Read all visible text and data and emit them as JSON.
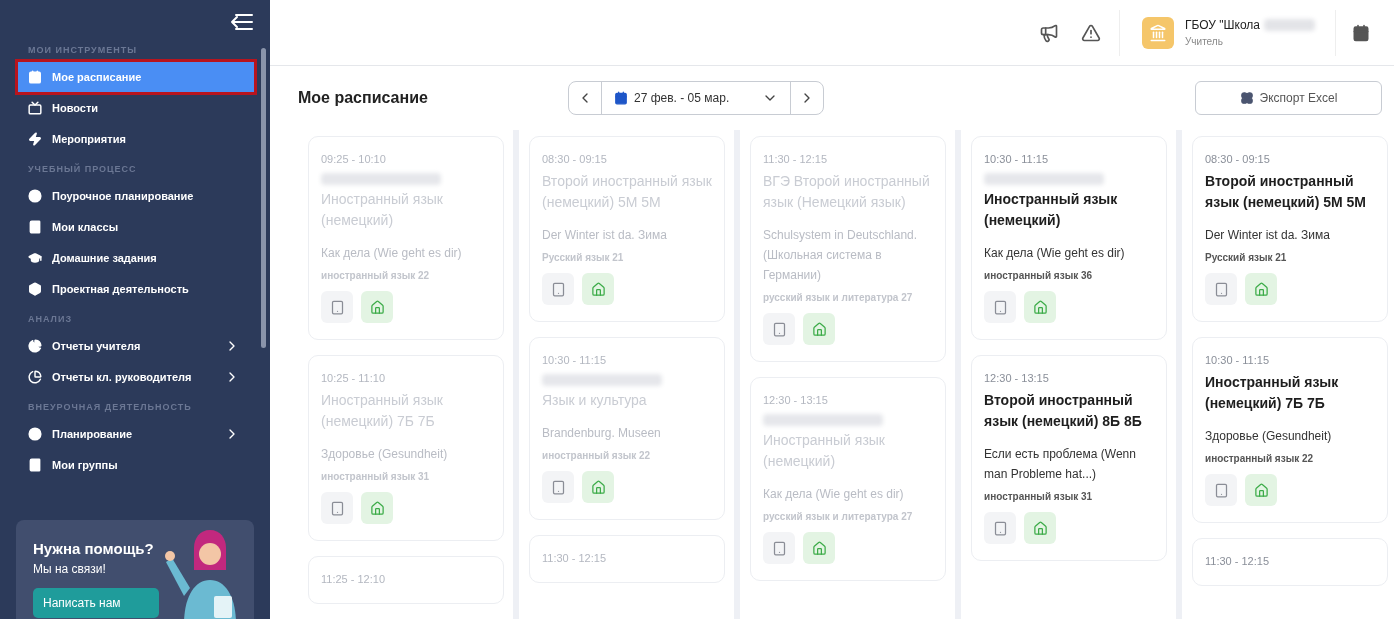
{
  "sidebar": {
    "sections": [
      {
        "heading": "МОИ ИНСТРУМЕНТЫ",
        "items": [
          {
            "label": "Мое расписание",
            "selected": true,
            "expandable": false
          },
          {
            "label": "Новости",
            "selected": false,
            "expandable": false
          },
          {
            "label": "Мероприятия",
            "selected": false,
            "expandable": false
          }
        ]
      },
      {
        "heading": "УЧЕБНЫЙ ПРОЦЕСС",
        "items": [
          {
            "label": "Поурочное планирование",
            "selected": false,
            "expandable": false
          },
          {
            "label": "Мои классы",
            "selected": false,
            "expandable": false
          },
          {
            "label": "Домашние задания",
            "selected": false,
            "expandable": false
          },
          {
            "label": "Проектная деятельность",
            "selected": false,
            "expandable": false
          }
        ]
      },
      {
        "heading": "АНАЛИЗ",
        "items": [
          {
            "label": "Отчеты учителя",
            "selected": false,
            "expandable": true
          },
          {
            "label": "Отчеты кл. руководителя",
            "selected": false,
            "expandable": true
          }
        ]
      },
      {
        "heading": "ВНЕУРОЧНАЯ ДЕЯТЕЛЬНОСТЬ",
        "items": [
          {
            "label": "Планирование",
            "selected": false,
            "expandable": true
          },
          {
            "label": "Мои группы",
            "selected": false,
            "expandable": false
          }
        ]
      }
    ],
    "help": {
      "title": "Нужна помощь?",
      "subtitle": "Мы на связи!",
      "button": "Написать нам"
    }
  },
  "header": {
    "org": {
      "name": "ГБОУ \"Школа",
      "name_redacted": true,
      "role": "Учитель"
    }
  },
  "toolbar": {
    "title": "Мое расписание",
    "date_range": "27 фев. - 05 мар.",
    "export_button": "Экспорт Excel"
  },
  "days": [
    {
      "lessons": [
        {
          "time": "09:25 - 10:10",
          "redacted": true,
          "past": true,
          "title": "Иностранный язык (немецкий)",
          "topic": "Как дела (Wie geht es dir)",
          "room": "иностранный язык 22"
        },
        {
          "time": "10:25 - 11:10",
          "redacted": false,
          "past": true,
          "title": "Иностранный язык (немецкий) 7Б 7Б",
          "topic": "Здоровье (Gesundheit)",
          "room": "иностранный язык 31"
        },
        {
          "time": "11:25 - 12:10",
          "redacted": false,
          "past": true
        }
      ]
    },
    {
      "lessons": [
        {
          "time": "08:30 - 09:15",
          "redacted": false,
          "past": true,
          "title": "Второй иностранный язык (немецкий) 5М 5М",
          "topic": "Der Winter ist da. Зима",
          "room": "Русский язык 21"
        },
        {
          "time": "10:30 - 11:15",
          "redacted": true,
          "past": true,
          "title": "Язык и культура",
          "topic": "Brandenburg. Museen",
          "room": "иностранный язык 22"
        },
        {
          "time": "11:30 - 12:15",
          "redacted": false,
          "past": true
        }
      ]
    },
    {
      "lessons": [
        {
          "time": "11:30 - 12:15",
          "redacted": false,
          "past": true,
          "title": "ВГЭ Второй иностранный язык (Немецкий язык)",
          "topic": "Schulsystem in Deutschland. (Школьная система в Германии)",
          "room": "русский язык и литература 27"
        },
        {
          "time": "12:30 - 13:15",
          "redacted": true,
          "past": true,
          "title": "Иностранный язык (немецкий)",
          "topic": "Как дела (Wie geht es dir)",
          "room": "русский язык и литература 27"
        }
      ]
    },
    {
      "lessons": [
        {
          "time": "10:30 - 11:15",
          "redacted": true,
          "past": false,
          "title": "Иностранный язык (немецкий)",
          "topic": "Как дела (Wie geht es dir)",
          "room": "иностранный язык 36"
        },
        {
          "time": "12:30 - 13:15",
          "redacted": false,
          "past": false,
          "title": "Второй иностранный язык (немецкий) 8Б 8Б",
          "topic": "Если есть проблема (Wenn man Probleme hat...)",
          "room": "иностранный язык 31"
        }
      ]
    },
    {
      "lessons": [
        {
          "time": "08:30 - 09:15",
          "redacted": false,
          "past": false,
          "title": "Второй иностранный язык (немецкий) 5М 5М",
          "topic": "Der Winter ist da. Зима",
          "room": "Русский язык 21"
        },
        {
          "time": "10:30 - 11:15",
          "redacted": false,
          "past": false,
          "title": "Иностранный язык (немецкий) 7Б 7Б",
          "topic": "Здоровье (Gesundheit)",
          "room": "иностранный язык 22"
        },
        {
          "time": "11:30 - 12:15",
          "redacted": false,
          "past": false
        }
      ]
    }
  ]
}
